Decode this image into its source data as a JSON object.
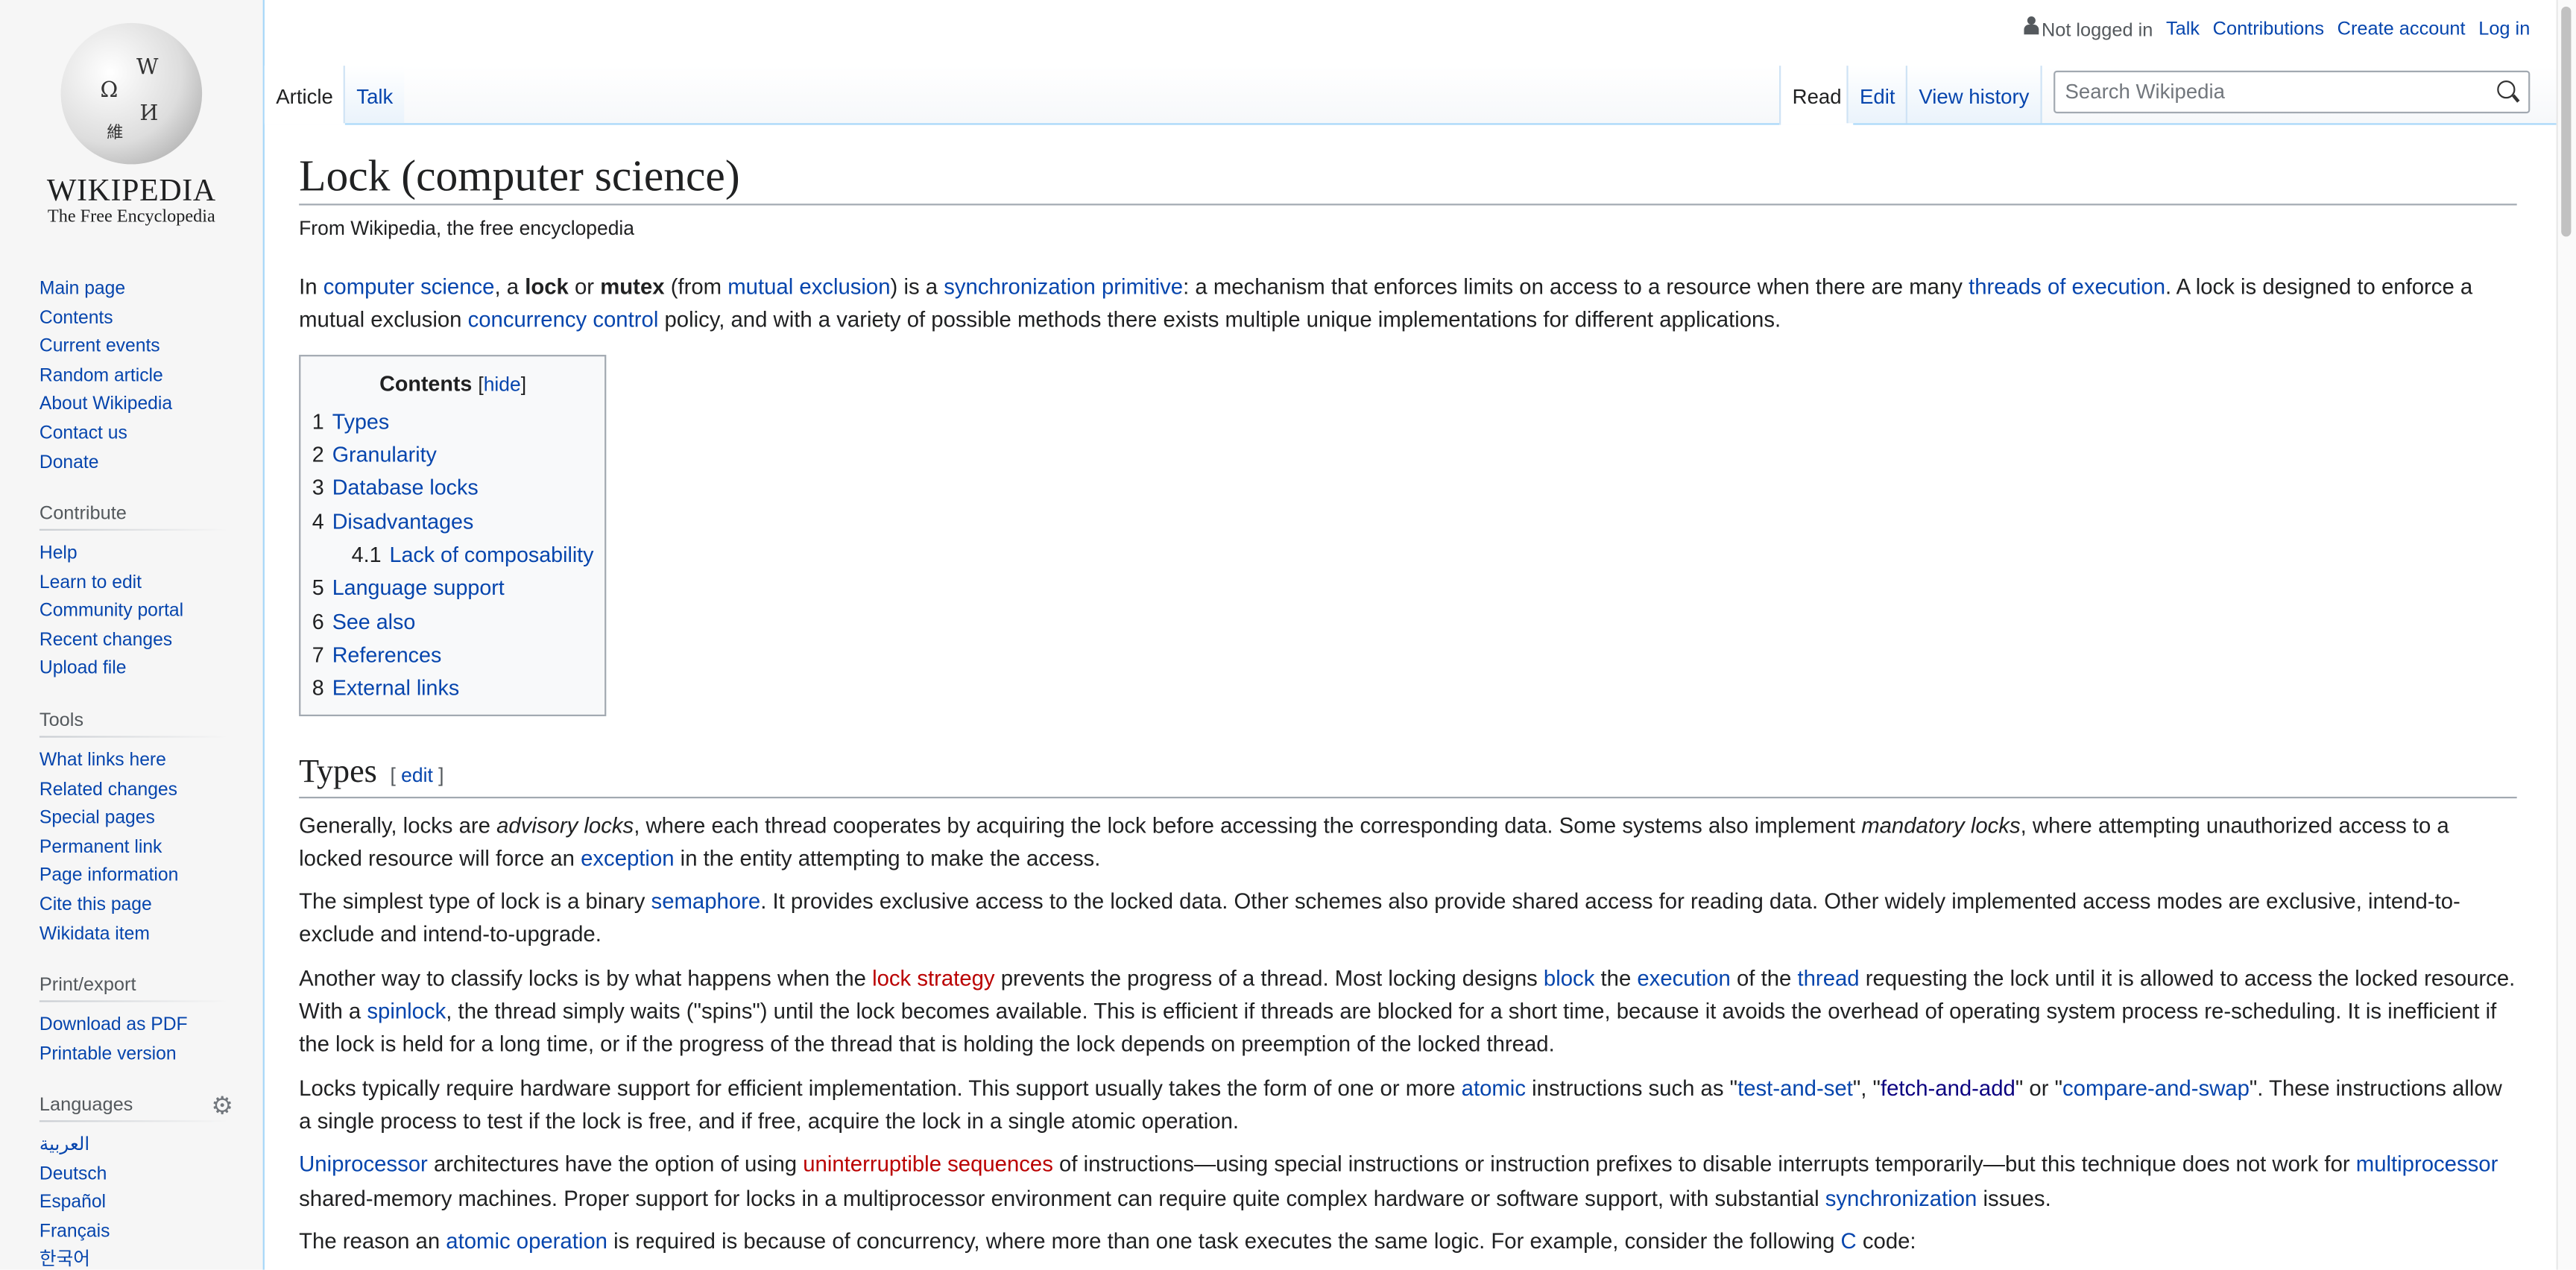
{
  "sidebar": {
    "logo": {
      "wordmark": "Wikipedia",
      "tagline": "The Free Encyclopedia"
    },
    "nav": [
      "Main page",
      "Contents",
      "Current events",
      "Random article",
      "About Wikipedia",
      "Contact us",
      "Donate"
    ],
    "contribute": {
      "title": "Contribute",
      "items": [
        "Help",
        "Learn to edit",
        "Community portal",
        "Recent changes",
        "Upload file"
      ]
    },
    "tools": {
      "title": "Tools",
      "items": [
        "What links here",
        "Related changes",
        "Special pages",
        "Permanent link",
        "Page information",
        "Cite this page",
        "Wikidata item"
      ]
    },
    "print": {
      "title": "Print/export",
      "items": [
        "Download as PDF",
        "Printable version"
      ]
    },
    "languages": {
      "title": "Languages",
      "icon": "gear-icon",
      "items": [
        "العربية",
        "Deutsch",
        "Español",
        "Français",
        "한국어"
      ]
    }
  },
  "personal": {
    "status": "Not logged in",
    "links": [
      "Talk",
      "Contributions",
      "Create account",
      "Log in"
    ]
  },
  "tabs": {
    "left": [
      "Article",
      "Talk"
    ],
    "right": [
      "Read",
      "Edit",
      "View history"
    ]
  },
  "search": {
    "placeholder": "Search Wikipedia",
    "value": ""
  },
  "article": {
    "title": "Lock (computer science)",
    "subtitle": "From Wikipedia, the free encyclopedia",
    "intro": [
      [
        {
          "t": "In "
        },
        {
          "t": "computer science",
          "l": 1
        },
        {
          "t": ", a "
        },
        {
          "t": "lock",
          "b": 1
        },
        {
          "t": " or "
        },
        {
          "t": "mutex",
          "b": 1
        },
        {
          "t": " (from "
        },
        {
          "t": "mutual exclusion",
          "l": 1
        },
        {
          "t": ") is a "
        },
        {
          "t": "synchronization primitive",
          "l": 1
        },
        {
          "t": ": a mechanism that enforces limits on access to a resource when there are many "
        },
        {
          "t": "threads of execution",
          "l": 1
        },
        {
          "t": ". A lock is designed to enforce a mutual exclusion "
        },
        {
          "t": "concurrency control",
          "l": 1
        },
        {
          "t": " policy, and with a variety of possible methods there exists multiple unique implementations for different applications."
        }
      ]
    ],
    "toc": {
      "title": "Contents",
      "hide": "hide",
      "items": [
        {
          "n": "1",
          "t": "Types"
        },
        {
          "n": "2",
          "t": "Granularity"
        },
        {
          "n": "3",
          "t": "Database locks"
        },
        {
          "n": "4",
          "t": "Disadvantages"
        },
        {
          "n": "4.1",
          "t": "Lack of composability",
          "sub": true
        },
        {
          "n": "5",
          "t": "Language support"
        },
        {
          "n": "6",
          "t": "See also"
        },
        {
          "n": "7",
          "t": "References"
        },
        {
          "n": "8",
          "t": "External links"
        }
      ]
    },
    "section": {
      "title": "Types",
      "edit": "edit"
    },
    "paragraphs": [
      [
        {
          "t": "Generally, locks are "
        },
        {
          "t": "advisory locks",
          "i": 1
        },
        {
          "t": ", where each thread cooperates by acquiring the lock before accessing the corresponding data. Some systems also implement "
        },
        {
          "t": "mandatory locks",
          "i": 1
        },
        {
          "t": ", where attempting unauthorized access to a locked resource will force an "
        },
        {
          "t": "exception",
          "l": 1
        },
        {
          "t": " in the entity attempting to make the access."
        }
      ],
      [
        {
          "t": "The simplest type of lock is a binary "
        },
        {
          "t": "semaphore",
          "l": 1
        },
        {
          "t": ". It provides exclusive access to the locked data. Other schemes also provide shared access for reading data. Other widely implemented access modes are exclusive, intend-to-exclude and intend-to-upgrade."
        }
      ],
      [
        {
          "t": "Another way to classify locks is by what happens when the "
        },
        {
          "t": "lock strategy",
          "l": 2
        },
        {
          "t": " prevents the progress of a thread. Most locking designs "
        },
        {
          "t": "block",
          "l": 1
        },
        {
          "t": " the "
        },
        {
          "t": "execution",
          "l": 1
        },
        {
          "t": " of the "
        },
        {
          "t": "thread",
          "l": 1
        },
        {
          "t": " requesting the lock until it is allowed to access the locked resource. With a "
        },
        {
          "t": "spinlock",
          "l": 1
        },
        {
          "t": ", the thread simply waits (\"spins\") until the lock becomes available. This is efficient if threads are blocked for a short time, because it avoids the overhead of operating system process re-scheduling. It is inefficient if the lock is held for a long time, or if the progress of the thread that is holding the lock depends on preemption of the locked thread."
        }
      ],
      [
        {
          "t": "Locks typically require hardware support for efficient implementation. This support usually takes the form of one or more "
        },
        {
          "t": "atomic",
          "l": 1
        },
        {
          "t": " instructions such as \""
        },
        {
          "t": "test-and-set",
          "l": 1
        },
        {
          "t": "\", \""
        },
        {
          "t": "fetch-and-add",
          "l": 3
        },
        {
          "t": "\" or \""
        },
        {
          "t": "compare-and-swap",
          "l": 1
        },
        {
          "t": "\". These instructions allow a single process to test if the lock is free, and if free, acquire the lock in a single atomic operation."
        }
      ],
      [
        {
          "t": "Uniprocessor",
          "l": 1
        },
        {
          "t": " architectures have the option of using "
        },
        {
          "t": "uninterruptible sequences",
          "l": 2
        },
        {
          "t": " of instructions—using special instructions or instruction prefixes to disable interrupts temporarily—but this technique does not work for "
        },
        {
          "t": "multiprocessor",
          "l": 1
        },
        {
          "t": " shared-memory machines. Proper support for locks in a multiprocessor environment can require quite complex hardware or software support, with substantial "
        },
        {
          "t": "synchronization",
          "l": 1
        },
        {
          "t": " issues."
        }
      ],
      [
        {
          "t": "The reason an "
        },
        {
          "t": "atomic operation",
          "l": 1
        },
        {
          "t": " is required is because of concurrency, where more than one task executes the same logic. For example, consider the following "
        },
        {
          "t": "C",
          "l": 1
        },
        {
          "t": " code:"
        }
      ]
    ]
  },
  "colors": {
    "link": "#0645ad",
    "redlink": "#ba0000",
    "visited": "#0b0080",
    "sidebar_bg": "#f6f6f6",
    "border": "#a7d7f9"
  }
}
